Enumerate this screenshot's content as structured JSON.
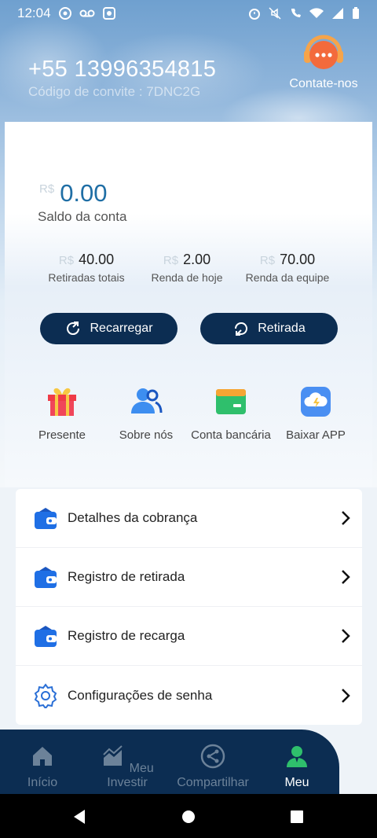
{
  "status_bar": {
    "time": "12:04"
  },
  "header": {
    "phone": "+55 13996354815",
    "invite": "Código de convite : 7DNC2G",
    "contact_label": "Contate-nos"
  },
  "balance": {
    "currency": "R$",
    "amount": "0.00",
    "label": "Saldo da conta"
  },
  "stats": [
    {
      "currency": "R$",
      "value": "40.00",
      "label": "Retiradas totais"
    },
    {
      "currency": "R$",
      "value": "2.00",
      "label": "Renda de hoje"
    },
    {
      "currency": "R$",
      "value": "70.00",
      "label": "Renda da equipe"
    }
  ],
  "actions": {
    "recharge": "Recarregar",
    "withdraw": "Retirada"
  },
  "features": [
    {
      "label": "Presente",
      "icon": "gift-icon"
    },
    {
      "label": "Sobre nós",
      "icon": "people-icon"
    },
    {
      "label": "Conta bancária",
      "icon": "bank-card-icon"
    },
    {
      "label": "Baixar APP",
      "icon": "cloud-download-icon"
    }
  ],
  "menu": [
    {
      "label": "Detalhes da cobrança",
      "icon": "wallet-icon"
    },
    {
      "label": "Registro de retirada",
      "icon": "wallet-icon"
    },
    {
      "label": "Registro de recarga",
      "icon": "wallet-icon"
    },
    {
      "label": "Configurações de senha",
      "icon": "gear-icon"
    }
  ],
  "nav": [
    {
      "label": "Início",
      "icon": "home-icon"
    },
    {
      "label": "Meu Investir",
      "icon": "chart-icon"
    },
    {
      "label": "Compartilhar",
      "icon": "share-icon"
    },
    {
      "label": "Meu",
      "icon": "user-icon"
    }
  ],
  "colors": {
    "primary": "#0c2d52",
    "accent": "#1f6ea5",
    "contact_orange": "#f36a3c"
  }
}
